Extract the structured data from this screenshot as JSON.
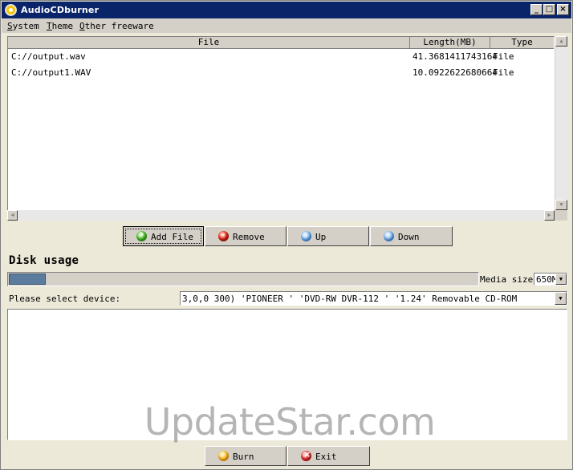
{
  "window": {
    "title": "AudioCDburner"
  },
  "menu": [
    "System",
    "Theme",
    "Other freeware"
  ],
  "filelist": {
    "columns": [
      "File",
      "Length(MB)",
      "Type"
    ],
    "rows": [
      {
        "file": "C://output.wav",
        "length": "41.3681411743164",
        "type": "File"
      },
      {
        "file": "C://output1.WAV",
        "length": "10.0922622680664",
        "type": "File"
      }
    ]
  },
  "buttons": {
    "add": "Add File",
    "remove": "Remove",
    "up": "Up",
    "down": "Down",
    "burn": "Burn",
    "exit": "Exit"
  },
  "disk": {
    "title": "Disk usage",
    "usage_fraction": 0.078,
    "media_label": "Media size:",
    "media_value": "650M"
  },
  "device": {
    "label": "Please select device:",
    "value": "3,0,0   300) 'PIONEER ' 'DVD-RW  DVR-112 ' '1.24' Removable CD-ROM"
  },
  "watermark": "UpdateStar.com",
  "icons": {
    "app": "cd-icon",
    "add": "green-arrow-icon",
    "remove": "red-minus-icon",
    "up": "blue-up-icon",
    "down": "blue-down-icon",
    "burn": "burn-icon",
    "exit": "exit-icon"
  }
}
